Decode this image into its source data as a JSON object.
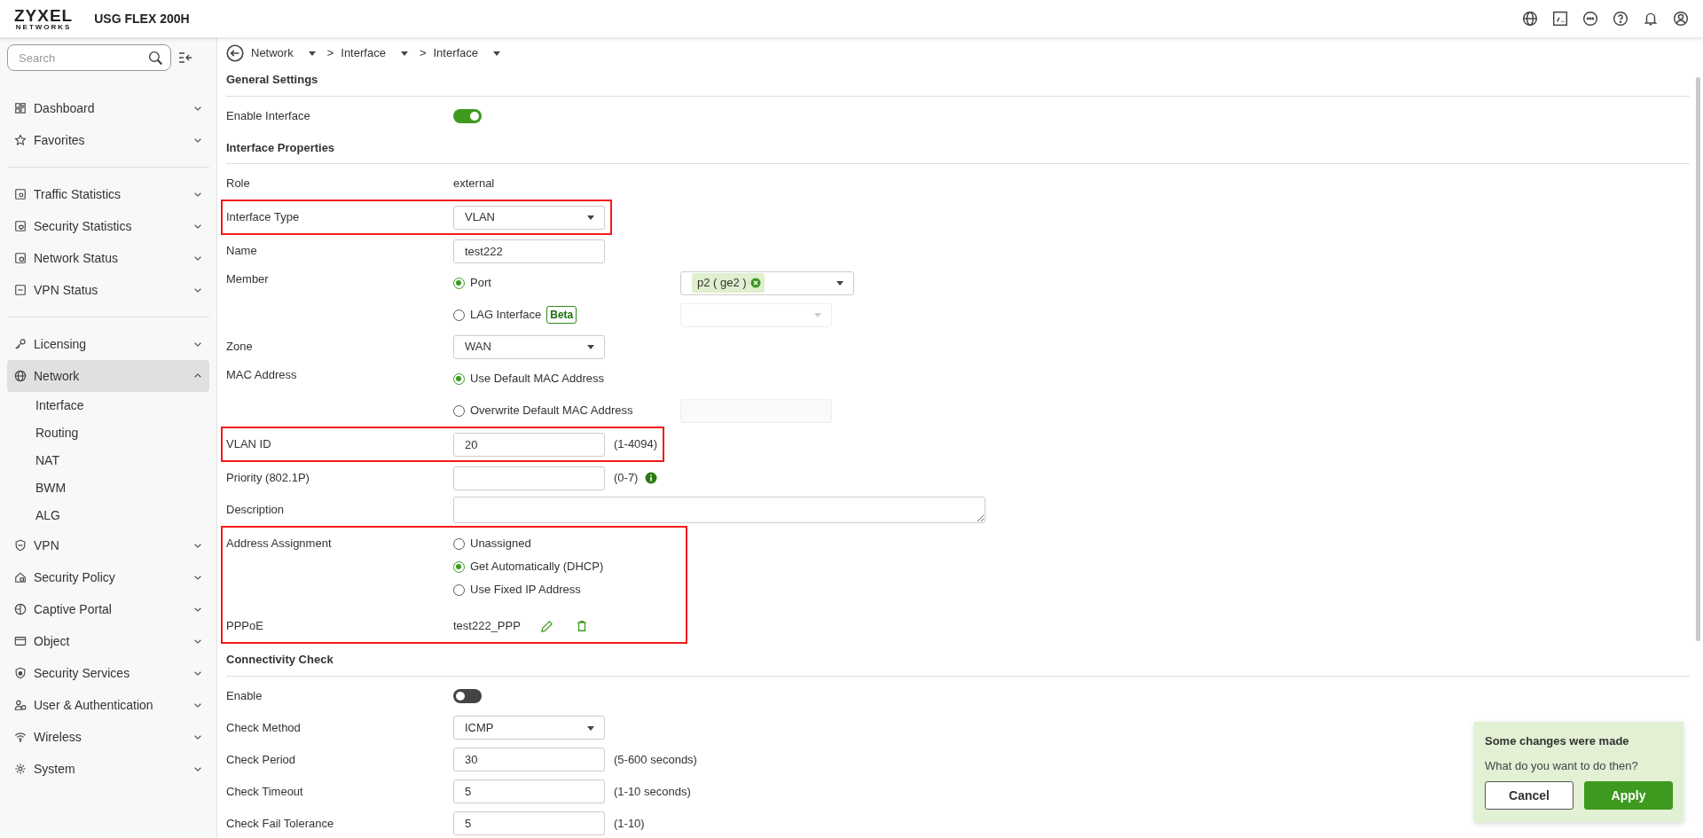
{
  "header": {
    "logo": "ZYXEL",
    "logo_sub": "NETWORKS",
    "product": "USG FLEX 200H"
  },
  "sidebar": {
    "search": {
      "placeholder": "Search"
    },
    "groups": [
      {
        "items": [
          {
            "label": "Dashboard",
            "selected": false,
            "expanded": false
          },
          {
            "label": "Favorites",
            "selected": false,
            "expanded": false
          }
        ]
      },
      {
        "items": [
          {
            "label": "Traffic Statistics",
            "selected": false,
            "expanded": false
          },
          {
            "label": "Security Statistics",
            "selected": false,
            "expanded": false
          },
          {
            "label": "Network Status",
            "selected": false,
            "expanded": false
          },
          {
            "label": "VPN Status",
            "selected": false,
            "expanded": false
          }
        ]
      },
      {
        "items": [
          {
            "label": "Licensing",
            "selected": false,
            "expanded": false
          },
          {
            "label": "Network",
            "selected": true,
            "expanded": true,
            "children": [
              {
                "label": "Interface"
              },
              {
                "label": "Routing"
              },
              {
                "label": "NAT"
              },
              {
                "label": "BWM"
              },
              {
                "label": "ALG"
              }
            ]
          },
          {
            "label": "VPN",
            "selected": false,
            "expanded": false
          },
          {
            "label": "Security Policy",
            "selected": false,
            "expanded": false
          },
          {
            "label": "Captive Portal",
            "selected": false,
            "expanded": false
          },
          {
            "label": "Object",
            "selected": false,
            "expanded": false
          },
          {
            "label": "Security Services",
            "selected": false,
            "expanded": false
          },
          {
            "label": "User & Authentication",
            "selected": false,
            "expanded": false
          },
          {
            "label": "Wireless",
            "selected": false,
            "expanded": false
          },
          {
            "label": "System",
            "selected": false,
            "expanded": false
          }
        ]
      }
    ]
  },
  "breadcrumb": [
    {
      "label": "Network"
    },
    {
      "separator": ">",
      "label": "Interface"
    },
    {
      "separator": ">",
      "label": "Interface"
    }
  ],
  "sections": [
    {
      "title": "General Settings",
      "rows": [
        {
          "kind": "toggle",
          "label": "Enable Interface",
          "on": true
        }
      ]
    },
    {
      "title": "Interface Properties",
      "rows": [
        {
          "kind": "text",
          "label": "Role",
          "value": "external"
        },
        {
          "kind": "select",
          "label": "Interface Type",
          "value": "VLAN",
          "highlighted": true
        },
        {
          "kind": "input",
          "label": "Name",
          "value": "test222"
        },
        {
          "kind": "radio",
          "label": "Member",
          "options": [
            {
              "label": "Port",
              "selected": true,
              "side": {
                "kind": "tags",
                "tags": [
                  "p2 ( ge2 )"
                ],
                "disabled": false
              }
            },
            {
              "label": "LAG Interface",
              "badge": "Beta",
              "selected": false,
              "side": {
                "kind": "select",
                "disabled": true
              }
            }
          ]
        },
        {
          "kind": "select",
          "label": "Zone",
          "value": "WAN"
        },
        {
          "kind": "radio",
          "label": "MAC Address",
          "options": [
            {
              "label": "Use Default MAC Address",
              "selected": true
            },
            {
              "label": "Overwrite Default MAC Address",
              "selected": false,
              "side": {
                "kind": "input",
                "disabled": true
              }
            }
          ]
        },
        {
          "kind": "input",
          "label": "VLAN ID",
          "value": "20",
          "hint": "(1-4094)",
          "highlighted": true
        },
        {
          "kind": "input",
          "label": "Priority (802.1P)",
          "hint": "(0-7)",
          "info": true
        },
        {
          "kind": "textarea",
          "label": "Description"
        },
        {
          "kind": "radio",
          "label": "Address Assignment",
          "highlighted": true,
          "options": [
            {
              "label": "Unassigned",
              "selected": false
            },
            {
              "label": "Get Automatically (DHCP)",
              "selected": true
            },
            {
              "label": "Use Fixed IP Address",
              "selected": false
            }
          ]
        },
        {
          "kind": "pppoe",
          "label": "PPPoE",
          "value": "test222_PPP",
          "highlighted": true
        }
      ]
    },
    {
      "title": "Connectivity Check",
      "rows": [
        {
          "kind": "toggle",
          "label": "Enable",
          "on": false
        },
        {
          "kind": "select",
          "label": "Check Method",
          "value": "ICMP"
        },
        {
          "kind": "input",
          "label": "Check Period",
          "value": "30",
          "hint": "(5-600 seconds)"
        },
        {
          "kind": "input",
          "label": "Check Timeout",
          "value": "5",
          "hint": "(1-10 seconds)"
        },
        {
          "kind": "input",
          "label": "Check Fail Tolerance",
          "value": "5",
          "hint": "(1-10)"
        }
      ]
    }
  ],
  "toast": {
    "title": "Some changes were made",
    "message": "What do you want to do then?",
    "buttons": [
      {
        "label": "Cancel",
        "kind": "secondary"
      },
      {
        "label": "Apply",
        "kind": "primary"
      }
    ]
  }
}
